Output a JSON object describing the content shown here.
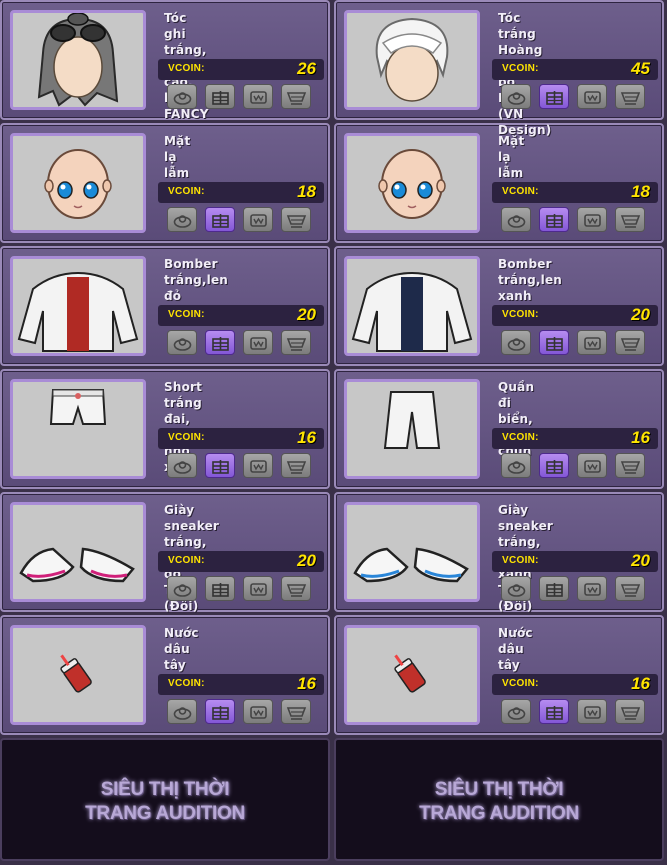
{
  "vcoin_label": "VCOIN:",
  "items": [
    {
      "name": "Tóc ghi trắng, buộc cao, kính FANCY",
      "price": "26",
      "illustration": "hair-gray-goggles",
      "active_button": "none"
    },
    {
      "name": "Tóc trắng Hoàng Tử bộ Elsa (VN Design)",
      "price": "45",
      "illustration": "hair-white",
      "active_button": "gift"
    },
    {
      "name": "Mặt lạ lẫm",
      "price": "18",
      "illustration": "face",
      "active_button": "gift"
    },
    {
      "name": "Mặt lạ lẫm",
      "price": "18",
      "illustration": "face",
      "active_button": "gift"
    },
    {
      "name": "Bomber trắng,len đỏ (Đôi)",
      "price": "20",
      "illustration": "jacket-red",
      "active_button": "gift"
    },
    {
      "name": "Bomber trắng,len xanh (Đôi)",
      "price": "20",
      "illustration": "jacket-navy",
      "active_button": "gift"
    },
    {
      "name": "Short trắng đai, nơ nhỏ xinh",
      "price": "16",
      "illustration": "shorts",
      "active_button": "gift"
    },
    {
      "name": "Quần đi biển, quá chun",
      "price": "16",
      "illustration": "long-shorts",
      "active_button": "gift"
    },
    {
      "name": "Giày sneaker trắng, viền đỏ Tươi (Đôi)",
      "price": "20",
      "illustration": "sneaker-pink",
      "active_button": "none"
    },
    {
      "name": "Giày sneaker trắng, viền xanh Tươi (Đôi)",
      "price": "20",
      "illustration": "sneaker-blue",
      "active_button": "none"
    },
    {
      "name": "Nước dâu tây",
      "price": "16",
      "illustration": "drink",
      "active_button": "gift"
    },
    {
      "name": "Nước dâu tây",
      "price": "16",
      "illustration": "drink",
      "active_button": "gift"
    }
  ],
  "buttons": [
    {
      "id": "try",
      "icon": "fitting-icon"
    },
    {
      "id": "gift",
      "icon": "gift-box-icon"
    },
    {
      "id": "wish",
      "icon": "wishlist-icon"
    },
    {
      "id": "cart",
      "icon": "shopping-cart-icon"
    }
  ],
  "banner_text": "SIÊU THỊ THỜI\nTRANG AUDITION"
}
